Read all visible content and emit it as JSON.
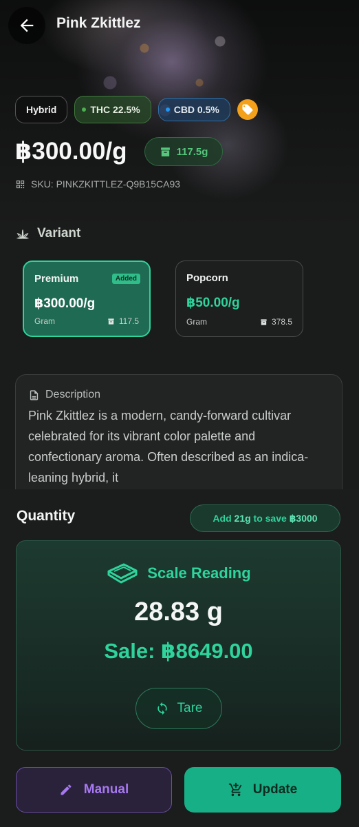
{
  "header": {
    "title": "Pink Zkittlez"
  },
  "product": {
    "type_chip": "Hybrid",
    "thc_chip": "THC 22.5%",
    "cbd_chip": "CBD 0.5%",
    "price": "฿300.00/g",
    "stock": "117.5g",
    "sku": "SKU: PINKZKITTLEZ-Q9B15CA93"
  },
  "variant": {
    "heading": "Variant",
    "items": [
      {
        "name": "Premium",
        "badge": "Added",
        "price": "฿300.00/g",
        "unit": "Gram",
        "stock": "117.5"
      },
      {
        "name": "Popcorn",
        "price": "฿50.00/g",
        "unit": "Gram",
        "stock": "378.5"
      }
    ]
  },
  "description": {
    "heading": "Description",
    "text": "Pink Zkittlez is a modern, candy-forward cultivar celebrated for its vibrant color palette and confectionary aroma. Often described as an indica-leaning hybrid, it"
  },
  "quantity": {
    "title": "Quantity",
    "save_prefix": "Add ",
    "save_amount": "21g",
    "save_middle": " to save ",
    "save_value": "฿3000"
  },
  "scale": {
    "heading": "Scale Reading",
    "weight": "28.83 g",
    "sale": "Sale: ฿8649.00",
    "tare_label": "Tare"
  },
  "actions": {
    "manual_label": "Manual",
    "update_label": "Update"
  },
  "colors": {
    "accent": "#2fd39c",
    "thc": "#4caf50",
    "cbd": "#2196f3",
    "tag": "#f3a01a",
    "manual": "#a678f0"
  },
  "icons": [
    "arrow-back-icon",
    "tag-icon",
    "archive-icon",
    "qr-code-icon",
    "cannabis-leaf-icon",
    "document-icon",
    "scale-icon",
    "refresh-icon",
    "pencil-icon",
    "cart-add-icon"
  ]
}
